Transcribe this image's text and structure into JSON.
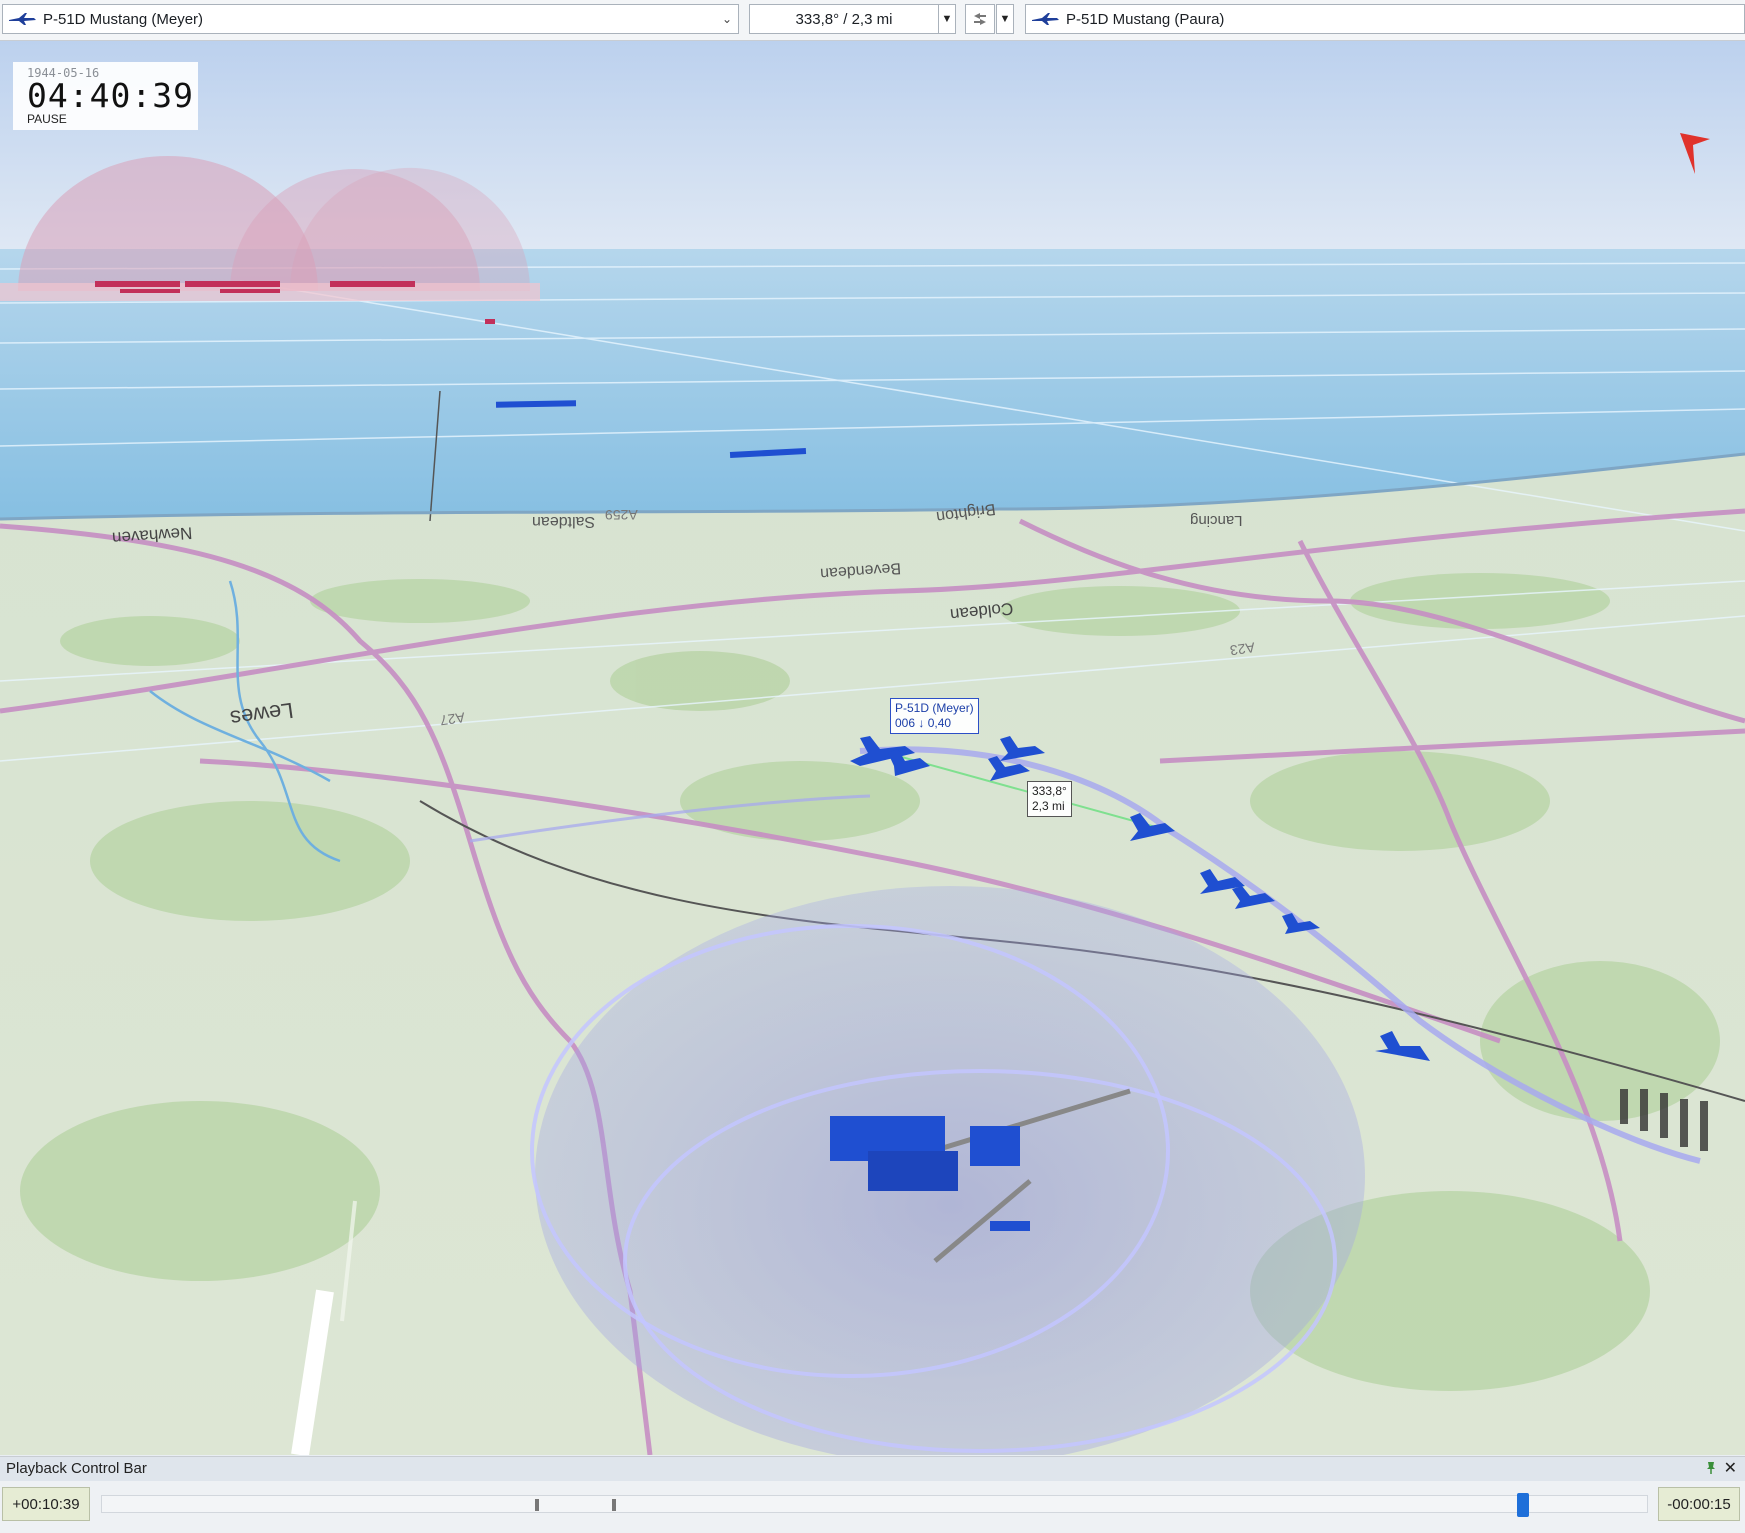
{
  "toolbar": {
    "left_entity": "P-51D Mustang (Meyer)",
    "measurement": "333,8° / 2,3 mi",
    "right_entity": "P-51D Mustang (Paura)"
  },
  "clock": {
    "date": "1944-05-16",
    "time": "04:40:39",
    "state": "PAUSE"
  },
  "map_labels": {
    "aircraft_tag_name": "P-51D (Meyer)",
    "aircraft_tag_data": "006 ↓ 0,40",
    "range_bearing": "333,8°",
    "range_distance": "2,3 mi",
    "towns": [
      "Newhaven",
      "Saltdean",
      "Brighton",
      "Bevendean",
      "Coldean",
      "Lewes",
      "Lancing"
    ],
    "roads": [
      "A259",
      "A27",
      "A23"
    ]
  },
  "playback": {
    "title": "Playback Control Bar",
    "elapsed": "+00:10:39",
    "remaining": "-00:00:15",
    "progress": 0.92,
    "markers": [
      0.28,
      0.33
    ]
  },
  "colors": {
    "friendly": "#1f4fd1",
    "hostile": "#c2305a",
    "sea": "#8ec3e3",
    "sky": "#c9dcf1"
  }
}
